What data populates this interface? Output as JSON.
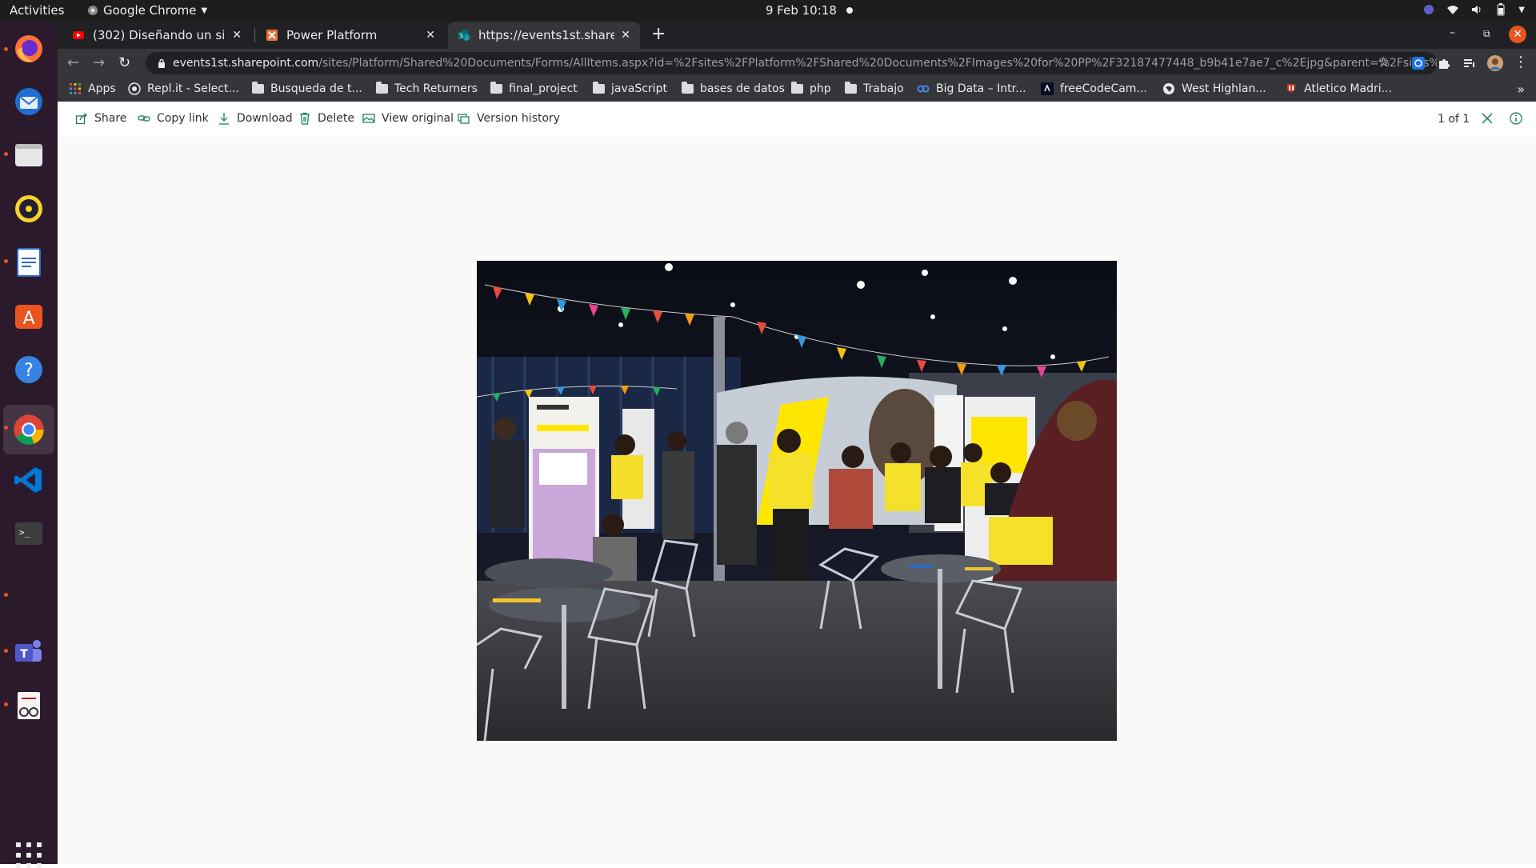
{
  "topbar": {
    "activities": "Activities",
    "app_name": "Google Chrome",
    "clock": "9 Feb  10:18"
  },
  "dock": {
    "items": [
      "Firefox",
      "Thunderbird",
      "Files",
      "Rhythmbox",
      "LibreOffice Writer",
      "Ubuntu Software",
      "Help",
      "Google Chrome",
      "Visual Studio Code",
      "Terminal",
      "Microsoft Teams",
      "Document Viewer"
    ],
    "active": "Google Chrome",
    "accent": "#e95420"
  },
  "tabs": [
    {
      "title": "(302) Diseñando un sideb",
      "icon": "youtube-icon"
    },
    {
      "title": "Power Platform",
      "icon": "power-platform-icon"
    },
    {
      "title": "https://events1st.sharep",
      "icon": "sharepoint-icon",
      "active": true
    }
  ],
  "omnibox": {
    "host": "events1st.sharepoint.com",
    "path": "/sites/Platform/Shared%20Documents/Forms/AllItems.aspx?id=%2Fsites%2FPlatform%2FShared%20Documents%2FImages%20for%20PP%2F32187477448_b9b41e7ae7_c%2Ejpg&parent=%2Fsites%2FPlat..."
  },
  "bookmarks": [
    {
      "label": "Apps",
      "icon": "apps-grid-icon"
    },
    {
      "label": "Repl.it - Select...",
      "icon": "replit-icon"
    },
    {
      "label": "Busqueda de t...",
      "icon": "folder-icon"
    },
    {
      "label": "Tech Returners",
      "icon": "folder-icon"
    },
    {
      "label": "final_project",
      "icon": "folder-icon"
    },
    {
      "label": "javaScript",
      "icon": "folder-icon"
    },
    {
      "label": "bases de datos",
      "icon": "folder-icon"
    },
    {
      "label": "php",
      "icon": "folder-icon"
    },
    {
      "label": "Trabajo",
      "icon": "folder-icon"
    },
    {
      "label": "Big Data – Intr...",
      "icon": "link-icon"
    },
    {
      "label": "freeCodeCam...",
      "icon": "freecodecamp-icon"
    },
    {
      "label": "West Highlan...",
      "icon": "globe-icon"
    },
    {
      "label": "Atletico Madri...",
      "icon": "atletico-icon"
    }
  ],
  "commands": [
    {
      "label": "Share",
      "icon": "share-icon"
    },
    {
      "label": "Copy link",
      "icon": "link-icon"
    },
    {
      "label": "Download",
      "icon": "download-icon"
    },
    {
      "label": "Delete",
      "icon": "trash-icon"
    },
    {
      "label": "View original",
      "icon": "image-icon"
    },
    {
      "label": "Version history",
      "icon": "history-icon"
    }
  ],
  "viewer": {
    "pager": "1 of 1",
    "accent": "#107c41"
  }
}
